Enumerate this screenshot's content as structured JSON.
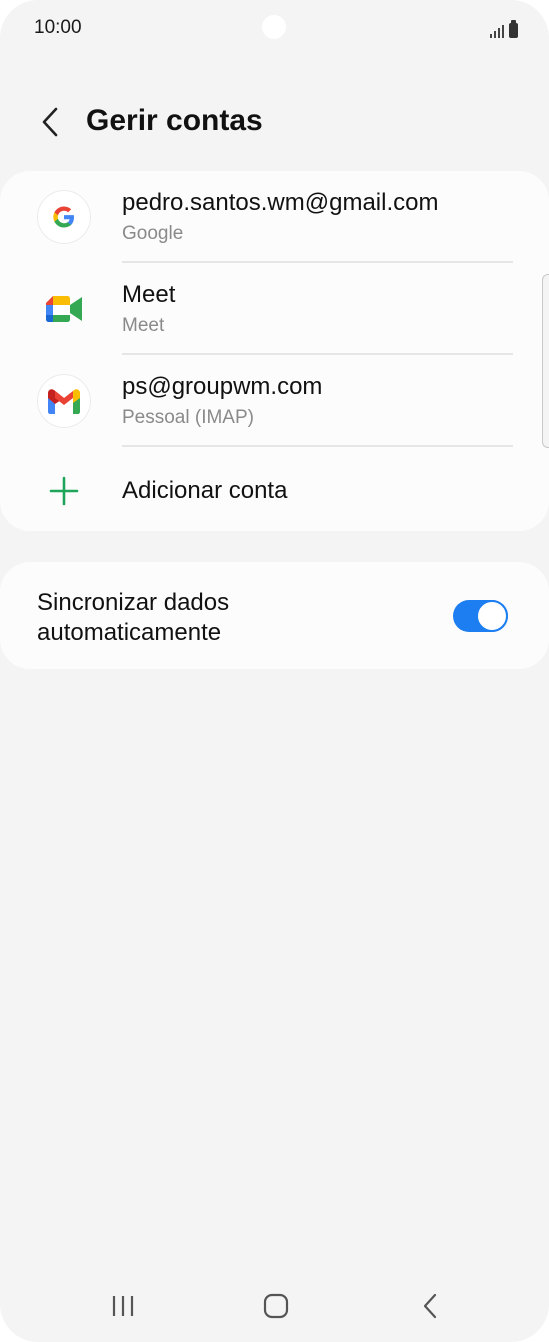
{
  "status_bar": {
    "time": "10:00"
  },
  "header": {
    "title": "Gerir contas",
    "back_icon": "chevron-left-icon"
  },
  "accounts": [
    {
      "title": "pedro.santos.wm@gmail.com",
      "subtitle": "Google",
      "icon": "google-icon"
    },
    {
      "title": "Meet",
      "subtitle": "Meet",
      "icon": "google-meet-icon"
    },
    {
      "title": "ps@groupwm.com",
      "subtitle": "Pessoal (IMAP)",
      "icon": "gmail-icon"
    }
  ],
  "add_account": {
    "label": "Adicionar conta",
    "icon": "plus-icon",
    "icon_color": "#1fa55a"
  },
  "sync": {
    "label_line1": "Sincronizar dados",
    "label_line2": "automaticamente",
    "toggle_on": true,
    "toggle_color": "#1c7ef0"
  },
  "navigation": {
    "recents_icon": "recent-apps-icon",
    "home_icon": "home-icon",
    "back_icon": "back-icon"
  }
}
